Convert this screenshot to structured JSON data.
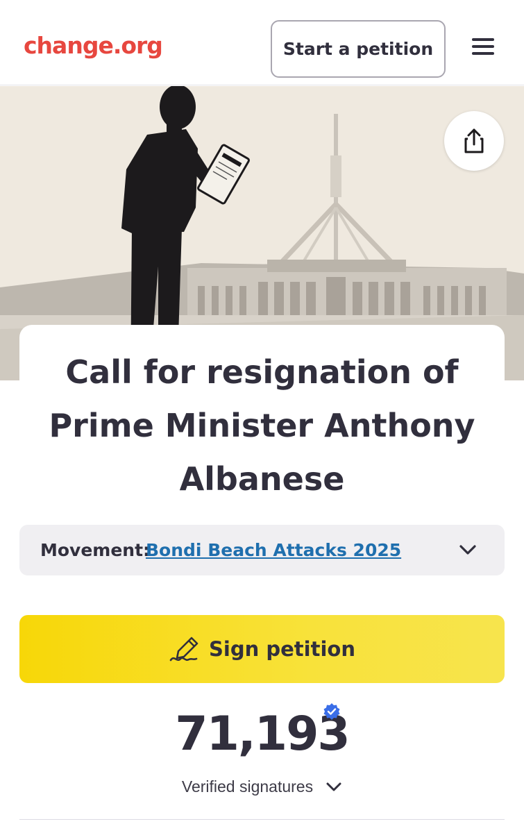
{
  "header": {
    "logo": "change.org",
    "start_button": "Start a petition",
    "menu_icon": "hamburger-menu-icon"
  },
  "hero": {
    "share_icon": "share-icon",
    "image_description_icon": "man-reading-document-parliament-house"
  },
  "petition": {
    "title": "Call for resignation of Prime Minister Anthony Albanese",
    "title_lines": [
      "Call for resignation of",
      "Prime Minister Anthony",
      "Albanese"
    ]
  },
  "movement": {
    "label": "Movement:",
    "link": "Bondi Beach Attacks 2025",
    "chevron_icon": "chevron-down-icon"
  },
  "sign": {
    "label": "Sign petition",
    "icon": "pen-signature-icon"
  },
  "signatures": {
    "count": "71,193",
    "label": "Verified signatures",
    "badge_icon": "verified-badge-icon",
    "chevron_icon": "chevron-down-icon"
  },
  "colors": {
    "brand": "#e7473f",
    "text": "#312f3d",
    "link": "#1f6fae",
    "sign_button": "#f7d708",
    "verified_badge": "#3a6ee8"
  }
}
